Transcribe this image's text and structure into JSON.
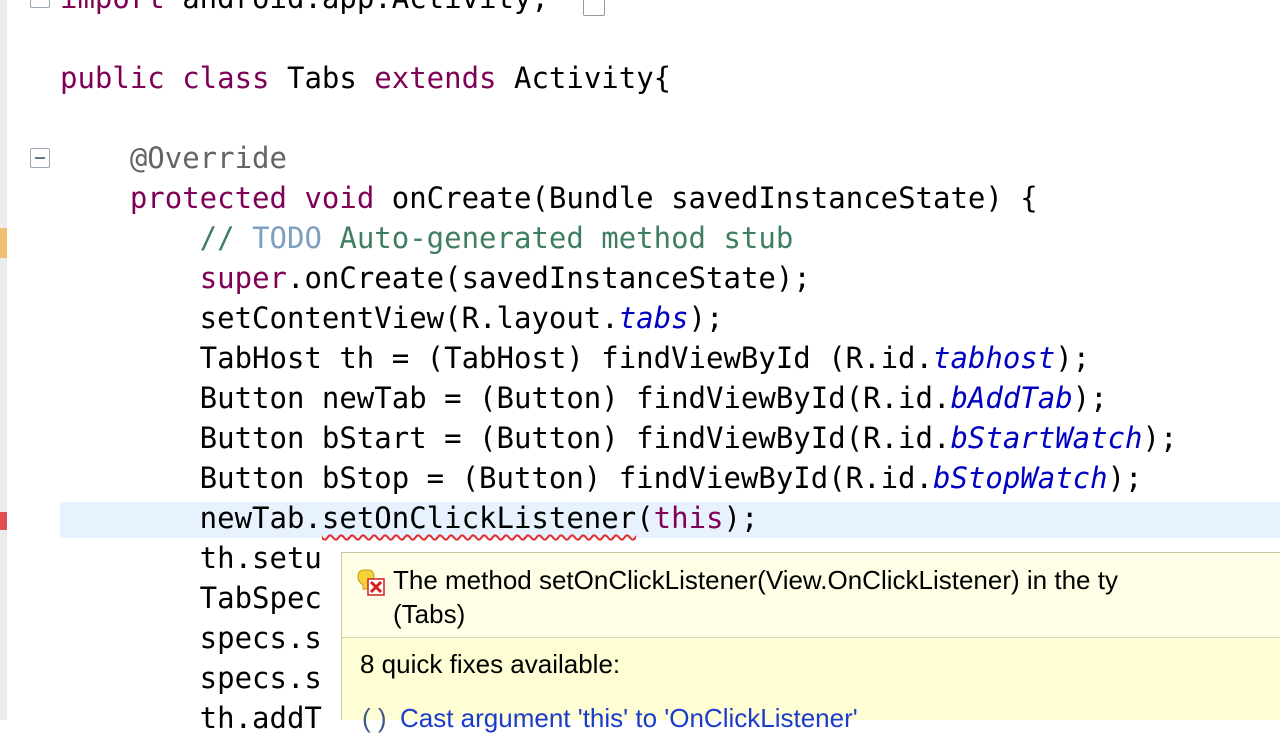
{
  "editor": {
    "lines": [
      {
        "segments": [
          {
            "t": "import android.app.Activity;",
            "c": "kw-partial"
          }
        ]
      },
      {
        "segments": []
      },
      {
        "segments": [
          {
            "t": "public class ",
            "c": "kw"
          },
          {
            "t": "Tabs ",
            "c": ""
          },
          {
            "t": "extends ",
            "c": "kw"
          },
          {
            "t": "Activity{",
            "c": ""
          }
        ]
      },
      {
        "segments": []
      },
      {
        "segments": [
          {
            "t": "    @Override",
            "c": "ann"
          }
        ]
      },
      {
        "segments": [
          {
            "t": "    ",
            "c": ""
          },
          {
            "t": "protected void ",
            "c": "kw"
          },
          {
            "t": "onCreate(Bundle savedInstanceState) {",
            "c": ""
          }
        ]
      },
      {
        "segments": [
          {
            "t": "        // ",
            "c": "cm"
          },
          {
            "t": "TODO",
            "c": "todo"
          },
          {
            "t": " Auto-generated method stub",
            "c": "cm"
          }
        ]
      },
      {
        "segments": [
          {
            "t": "        ",
            "c": ""
          },
          {
            "t": "super",
            "c": "kw"
          },
          {
            "t": ".onCreate(savedInstanceState);",
            "c": ""
          }
        ]
      },
      {
        "segments": [
          {
            "t": "        setContentView(R.layout.",
            "c": ""
          },
          {
            "t": "tabs",
            "c": "fld"
          },
          {
            "t": ");",
            "c": ""
          }
        ]
      },
      {
        "segments": [
          {
            "t": "        TabHost th = (TabHost) findViewById (R.id.",
            "c": ""
          },
          {
            "t": "tabhost",
            "c": "fld"
          },
          {
            "t": ");",
            "c": ""
          }
        ]
      },
      {
        "segments": [
          {
            "t": "        Button newTab = (Button) findViewById(R.id.",
            "c": ""
          },
          {
            "t": "bAddTab",
            "c": "fld"
          },
          {
            "t": ");",
            "c": ""
          }
        ]
      },
      {
        "segments": [
          {
            "t": "        Button bStart = (Button) findViewById(R.id.",
            "c": ""
          },
          {
            "t": "bStartWatch",
            "c": "fld"
          },
          {
            "t": ");",
            "c": ""
          }
        ]
      },
      {
        "segments": [
          {
            "t": "        Button bStop = (Button) findViewById(R.id.",
            "c": ""
          },
          {
            "t": "bStopWatch",
            "c": "fld"
          },
          {
            "t": ");",
            "c": ""
          }
        ]
      },
      {
        "segments": [
          {
            "t": "        newTab.",
            "c": ""
          },
          {
            "t": "setOnClickListener",
            "c": "sq"
          },
          {
            "t": "(",
            "c": ""
          },
          {
            "t": "this",
            "c": "kw"
          },
          {
            "t": ");",
            "c": ""
          }
        ]
      },
      {
        "segments": [
          {
            "t": "        th.setu",
            "c": ""
          }
        ]
      },
      {
        "segments": [
          {
            "t": "        TabSpec",
            "c": ""
          }
        ]
      },
      {
        "segments": [
          {
            "t": "        specs.s",
            "c": ""
          }
        ]
      },
      {
        "segments": [
          {
            "t": "        specs.s",
            "c": ""
          }
        ]
      },
      {
        "segments": [
          {
            "t": "        th.addT",
            "c": ""
          }
        ]
      }
    ]
  },
  "hover": {
    "message_line1": "The method setOnClickListener(View.OnClickListener) in the ty",
    "message_line2": "(Tabs)",
    "quick_fixes_count": "8 quick fixes available:",
    "first_fix": "Cast argument 'this' to 'OnClickListener'",
    "icon": "error-icon"
  },
  "colors": {
    "keyword": "#7f0055",
    "annotation": "#646464",
    "comment": "#3f7f5f",
    "field": "#0000c0",
    "hover_background": "#fffdd4"
  }
}
